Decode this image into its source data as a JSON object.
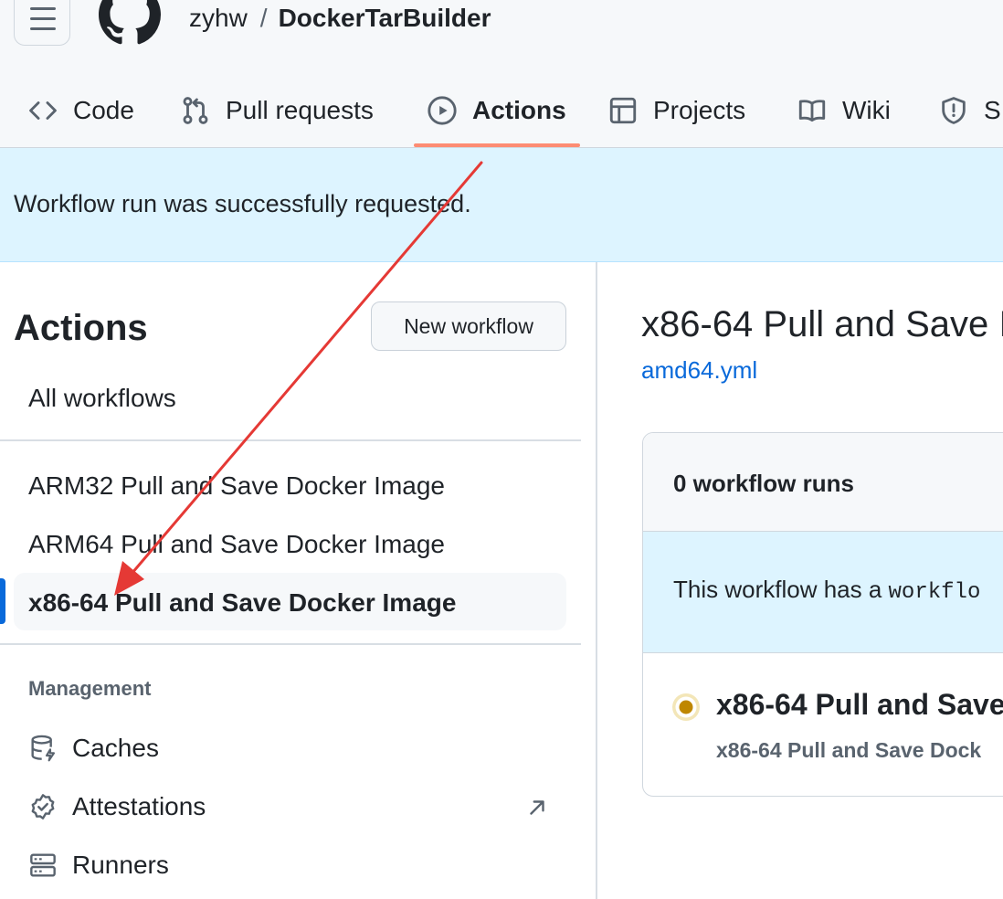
{
  "header": {
    "owner": "zyhw",
    "separator": "/",
    "repo": "DockerTarBuilder"
  },
  "nav": {
    "tabs": [
      {
        "label": "Code",
        "icon": "code-icon"
      },
      {
        "label": "Pull requests",
        "icon": "git-pull-request-icon"
      },
      {
        "label": "Actions",
        "icon": "play-icon",
        "selected": true
      },
      {
        "label": "Projects",
        "icon": "table-icon"
      },
      {
        "label": "Wiki",
        "icon": "book-icon"
      },
      {
        "label": "S",
        "icon": "shield-icon"
      }
    ],
    "selected_underline_color": "#fd8c73"
  },
  "flash": {
    "message": "Workflow run was successfully requested."
  },
  "sidebar": {
    "title": "Actions",
    "new_workflow_label": "New workflow",
    "all_workflows_label": "All workflows",
    "workflows": [
      {
        "label": "ARM32 Pull and Save Docker Image"
      },
      {
        "label": "ARM64 Pull and Save Docker Image"
      },
      {
        "label": "x86-64 Pull and Save Docker Image",
        "selected": true
      }
    ],
    "management_heading": "Management",
    "management_items": [
      {
        "label": "Caches",
        "icon": "database-icon"
      },
      {
        "label": "Attestations",
        "icon": "verified-icon",
        "external": true
      },
      {
        "label": "Runners",
        "icon": "server-icon"
      }
    ]
  },
  "main": {
    "title": "x86-64 Pull and Save I",
    "file_link": "amd64.yml",
    "runs_count": "0 workflow runs",
    "note_prefix": "This workflow has a ",
    "note_code": "workflo",
    "run": {
      "status": "queued",
      "title": "x86-64 Pull and Save",
      "subtitle": "x86-64 Pull and Save Dock"
    }
  },
  "annotation": {
    "type": "arrow",
    "color": "#e53935"
  }
}
